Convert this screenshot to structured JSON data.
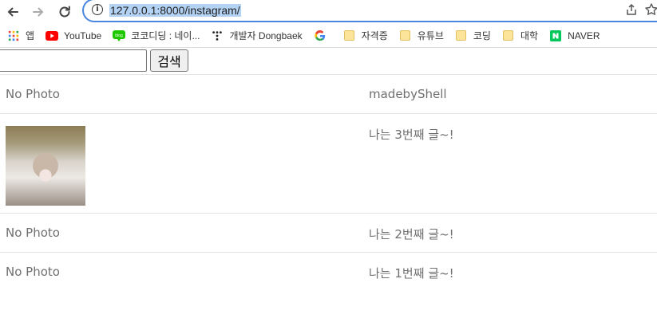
{
  "browser": {
    "url": "127.0.0.1:8000/instagram/",
    "bookmarks": [
      {
        "label": "앱",
        "icon": "apps-grid-icon"
      },
      {
        "label": "YouTube",
        "icon": "youtube-icon"
      },
      {
        "label": "코코디딩 : 네이...",
        "icon": "blog-icon"
      },
      {
        "label": "개발자 Dongbaek",
        "icon": "dots-logo-icon"
      },
      {
        "label": "",
        "icon": "google-icon"
      },
      {
        "label": "자격증",
        "icon": "folder-icon"
      },
      {
        "label": "유튜브",
        "icon": "folder-icon"
      },
      {
        "label": "코딩",
        "icon": "folder-icon"
      },
      {
        "label": "대학",
        "icon": "folder-icon"
      },
      {
        "label": "NAVER",
        "icon": "naver-icon"
      }
    ]
  },
  "search": {
    "value": "",
    "button_label": "검색"
  },
  "posts": [
    {
      "photo": "No Photo",
      "message": "madebyShell",
      "has_photo": false
    },
    {
      "photo": "",
      "message": "나는 3번째 글~!",
      "has_photo": true
    },
    {
      "photo": "No Photo",
      "message": "나는 2번째 글~!",
      "has_photo": false
    },
    {
      "photo": "No Photo",
      "message": "나는 1번째 글~!",
      "has_photo": false
    }
  ],
  "colors": {
    "accent": "#4a86e0",
    "url_highlight": "#b4d2f3",
    "text_muted": "#6f6f6f"
  }
}
